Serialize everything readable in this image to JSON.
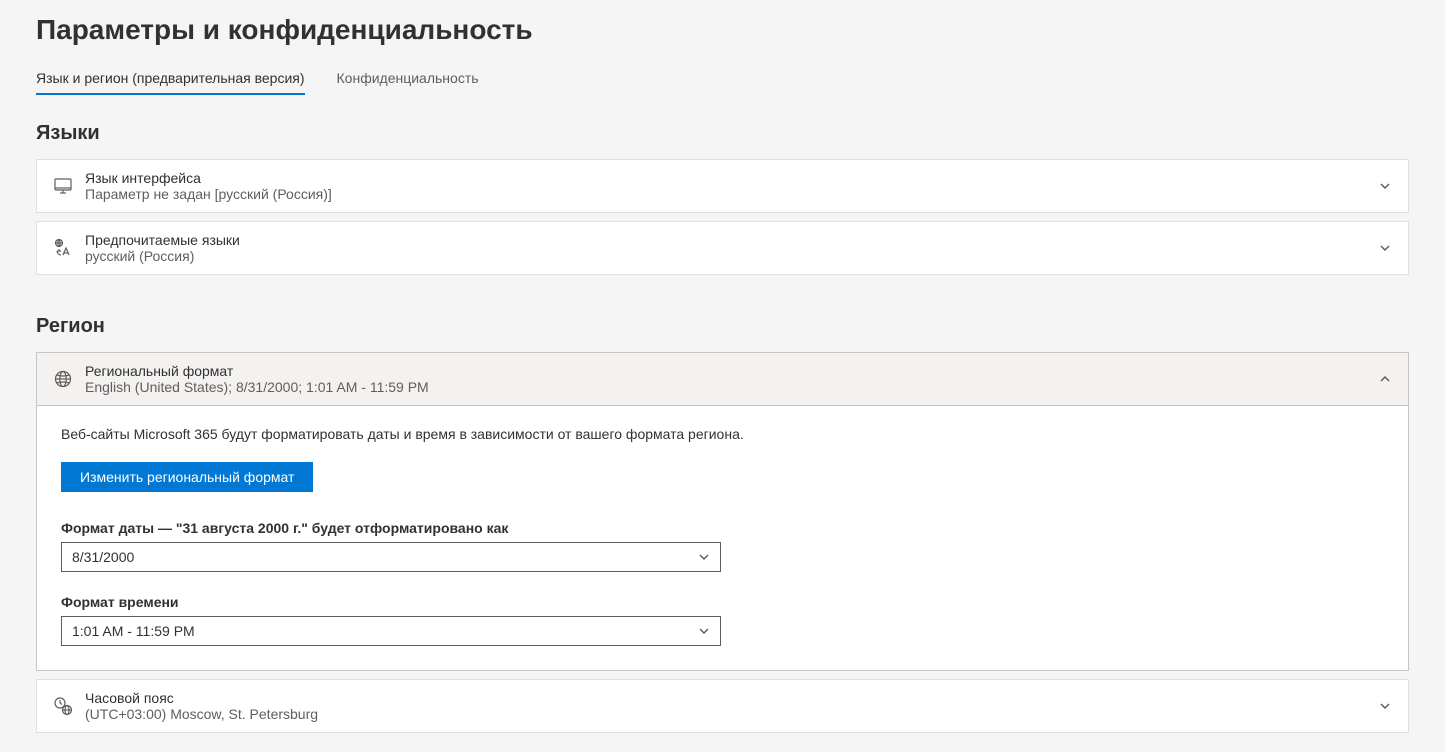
{
  "pageTitle": "Параметры и конфиденциальность",
  "tabs": {
    "langRegion": "Язык и регион (предварительная версия)",
    "privacy": "Конфиденциальность"
  },
  "sections": {
    "languages": "Языки",
    "region": "Регион"
  },
  "cards": {
    "uiLanguage": {
      "title": "Язык интерфейса",
      "sub": "Параметр не задан [русский (Россия)]"
    },
    "preferredLanguages": {
      "title": "Предпочитаемые языки",
      "sub": "русский (Россия)"
    },
    "regionalFormat": {
      "title": "Региональный формат",
      "sub": "English (United States); 8/31/2000; 1:01 AM - 11:59 PM"
    },
    "timezone": {
      "title": "Часовой пояс",
      "sub": "(UTC+03:00) Moscow, St. Petersburg"
    }
  },
  "regionalExpanded": {
    "desc": "Веб-сайты Microsoft 365 будут форматировать даты и время в зависимости от вашего формата региона.",
    "changeButton": "Изменить региональный формат",
    "dateFormatLabel": "Формат даты — \"31 августа 2000 г.\" будет отформатировано как",
    "dateFormatValue": "8/31/2000",
    "timeFormatLabel": "Формат времени",
    "timeFormatValue": "1:01 AM - 11:59 PM"
  }
}
